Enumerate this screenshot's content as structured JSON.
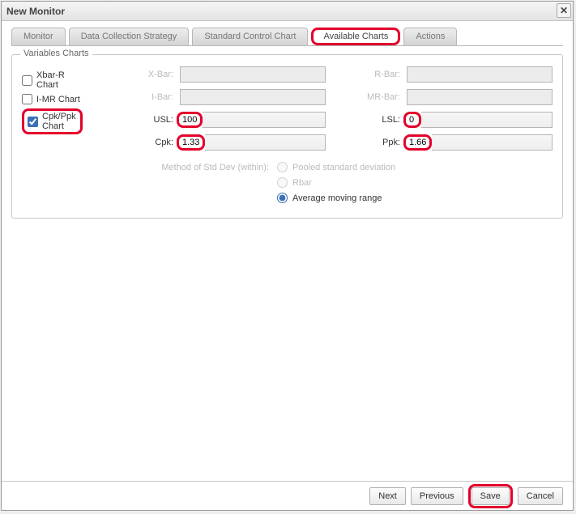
{
  "window": {
    "title": "New Monitor"
  },
  "tabs": {
    "monitor": "Monitor",
    "strategy": "Data Collection Strategy",
    "control": "Standard Control Chart",
    "available": "Available Charts",
    "actions": "Actions"
  },
  "fieldset_title": "Variables Charts",
  "checks": {
    "xbar_r": "Xbar-R Chart",
    "imr": "I-MR Chart",
    "cpk": "Cpk/Ppk Chart"
  },
  "labels": {
    "xbar": "X-Bar:",
    "rbar": "R-Bar:",
    "ibar": "I-Bar:",
    "mrbar": "MR-Bar:",
    "usl": "USL:",
    "lsl": "LSL:",
    "cpk": "Cpk:",
    "ppk": "Ppk:",
    "method": "Method of Std Dev (within):"
  },
  "values": {
    "usl": "100",
    "lsl": "0",
    "cpk": "1.33",
    "ppk": "1.66"
  },
  "radios": {
    "pooled": "Pooled standard deviation",
    "rbar": "Rbar",
    "amr": "Average moving range"
  },
  "buttons": {
    "next": "Next",
    "prev": "Previous",
    "save": "Save",
    "cancel": "Cancel"
  }
}
